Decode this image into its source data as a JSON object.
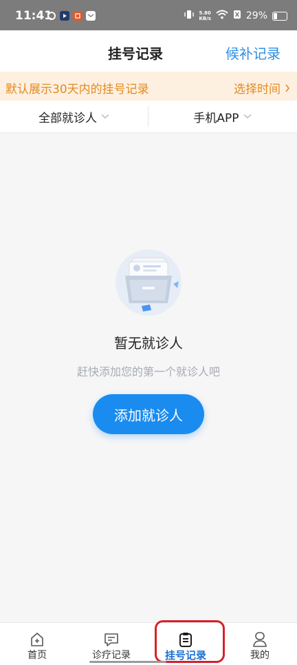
{
  "status_bar": {
    "time": "11:41",
    "net_speed_value": "5.80",
    "net_speed_unit": "KB/s",
    "battery": "29%"
  },
  "header": {
    "title": "挂号记录",
    "right_link": "候补记录"
  },
  "banner": {
    "text": "默认展示30天内的挂号记录",
    "action": "选择时间"
  },
  "filters": {
    "patient": "全部就诊人",
    "channel": "手机APP"
  },
  "empty_state": {
    "title": "暂无就诊人",
    "subtitle": "赶快添加您的第一个就诊人吧",
    "button": "添加就诊人"
  },
  "tabs": [
    {
      "label": "首页",
      "icon": "home-icon"
    },
    {
      "label": "诊疗记录",
      "icon": "message-icon"
    },
    {
      "label": "挂号记录",
      "icon": "clipboard-icon"
    },
    {
      "label": "我的",
      "icon": "user-icon"
    }
  ],
  "colors": {
    "accent": "#1a8cf0",
    "banner_text": "#e48a1f",
    "banner_bg": "#fdf0e1",
    "active_tab": "#1a6fd6",
    "highlight": "#d91e2a"
  }
}
